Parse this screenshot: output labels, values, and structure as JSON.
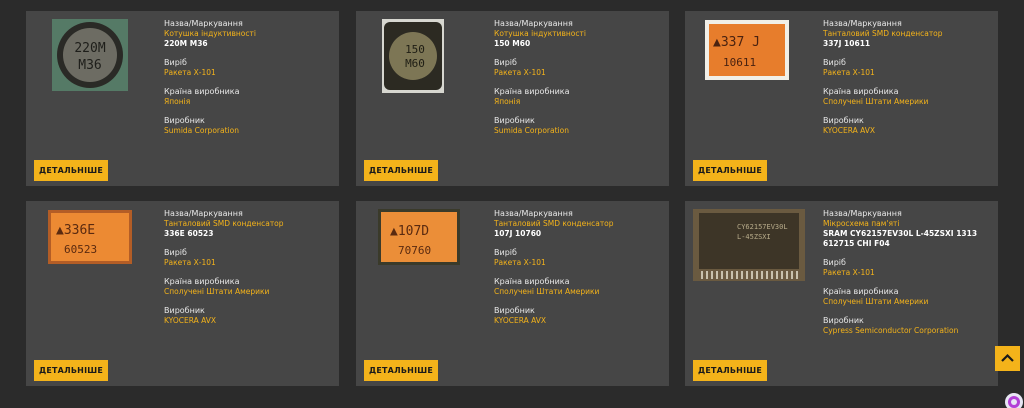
{
  "labels": {
    "name": "Назва/Маркування",
    "product": "Виріб",
    "country": "Країна виробника",
    "maker": "Виробник",
    "more": "ДЕТАЛЬНІШЕ"
  },
  "cards": [
    {
      "type": "Котушка індуктивності",
      "marking": "220M M36",
      "product": "Ракета Х-101",
      "country": "Японія",
      "maker": "Sumida Corporation",
      "img_text1": "220M",
      "img_text2": "M36"
    },
    {
      "type": "Котушка індуктивності",
      "marking": "150 M60",
      "product": "Ракета Х-101",
      "country": "Японія",
      "maker": "Sumida Corporation",
      "img_text1": "150",
      "img_text2": "M60"
    },
    {
      "type": "Танталовий SMD конденсатор",
      "marking": "337J 10611",
      "product": "Ракета Х-101",
      "country": "Сполучені Штати Америки",
      "maker": "KYOCERA AVX",
      "img_text1": "▲337 J",
      "img_text2": "10611"
    },
    {
      "type": "Танталовий SMD конденсатор",
      "marking": "336E 60523",
      "product": "Ракета Х-101",
      "country": "Сполучені Штати Америки",
      "maker": "KYOCERA AVX",
      "img_text1": "▲336E",
      "img_text2": "60523"
    },
    {
      "type": "Танталовий SMD конденсатор",
      "marking": "107J 10760",
      "product": "Ракета Х-101",
      "country": "Сполучені Штати Америки",
      "maker": "KYOCERA AVX",
      "img_text1": "▲107D",
      "img_text2": "70760"
    },
    {
      "type": "Мікросхема пам'яті",
      "marking": "SRAM CY62157EV30L L-45ZSXI 1313 612715 CHI F04",
      "product": "Ракета Х-101",
      "country": "Сполучені Штати Америки",
      "maker": "Cypress Semiconductor Corporation",
      "img_text1": "CY62157EV30L",
      "img_text2": "L-45ZSXI"
    }
  ],
  "colors": {
    "accent": "#f4b31a",
    "card_bg": "#464646",
    "page_bg": "#2b2b2b"
  },
  "icons": {
    "scroll_top": "chevron-up-icon",
    "chat": "chat-icon"
  }
}
